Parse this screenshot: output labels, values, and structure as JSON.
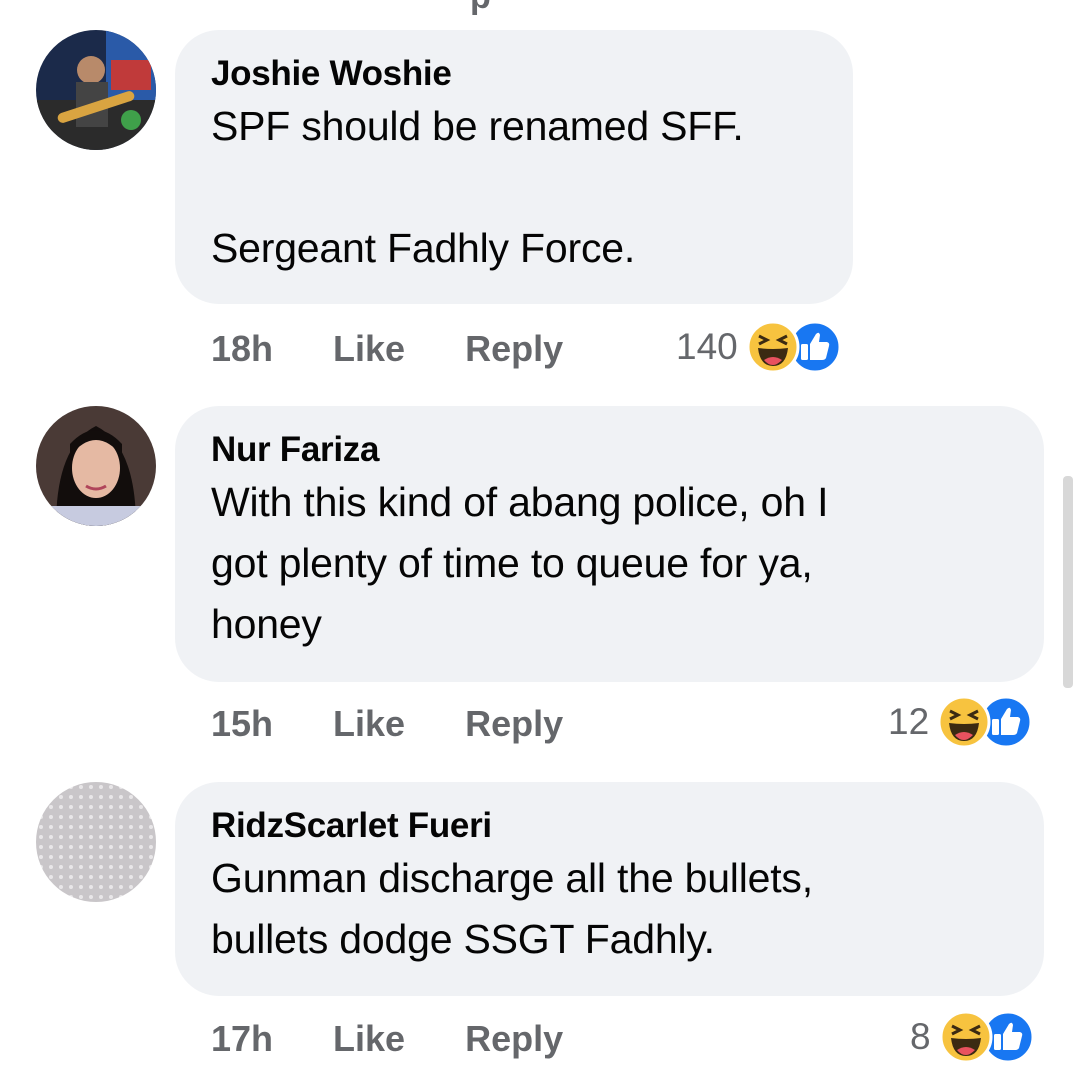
{
  "top_partial_label": "p",
  "colors": {
    "bubble_bg": "#f0f2f5",
    "meta_text": "#65676b",
    "like_blue": "#1877f2",
    "haha_yellow": "#f7c33f"
  },
  "comments": [
    {
      "author": "Joshie Woshie",
      "text": "SPF should be renamed SFF.\n\nSergeant Fadhly Force.",
      "time": "18h",
      "like_label": "Like",
      "reply_label": "Reply",
      "reaction_count": "140",
      "reaction_icons": [
        "haha-icon",
        "like-icon"
      ]
    },
    {
      "author": "Nur Fariza",
      "text": "With this kind of abang police, oh I\ngot plenty of time to queue for ya,\nhoney",
      "time": "15h",
      "like_label": "Like",
      "reply_label": "Reply",
      "reaction_count": "12",
      "reaction_icons": [
        "haha-icon",
        "like-icon"
      ]
    },
    {
      "author": "RidzScarlet Fueri",
      "text": "Gunman discharge all the bullets,\nbullets dodge SSGT Fadhly.",
      "time": "17h",
      "like_label": "Like",
      "reply_label": "Reply",
      "reaction_count": "8",
      "reaction_icons": [
        "haha-icon",
        "like-icon"
      ]
    }
  ]
}
